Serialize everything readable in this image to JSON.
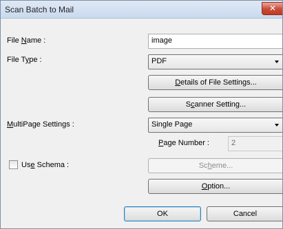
{
  "window": {
    "title": "Scan Batch to Mail",
    "close_symbol": "✕"
  },
  "labels": {
    "file_name": [
      "File ",
      "N",
      "ame :"
    ],
    "file_type": [
      "File T",
      "y",
      "pe :"
    ],
    "multipage": [
      "",
      "M",
      "ultiPage Settings :"
    ],
    "use_schema": [
      "Us",
      "e",
      " Schema :"
    ],
    "page_number": [
      "",
      "P",
      "age Number :"
    ]
  },
  "fields": {
    "file_name_value": "image",
    "file_type_value": "PDF",
    "multipage_value": "Single Page",
    "page_number_value": "2"
  },
  "buttons": {
    "details": [
      "",
      "D",
      "etails of File Settings..."
    ],
    "scanner": [
      "S",
      "c",
      "anner Setting..."
    ],
    "scheme": [
      "Sc",
      "h",
      "eme..."
    ],
    "option": [
      "",
      "O",
      "ption..."
    ],
    "ok": "OK",
    "cancel": "Cancel"
  },
  "checkbox": {
    "use_schema_checked": false
  },
  "icons": {
    "dropdown": "chevron-down-icon",
    "close": "close-icon"
  }
}
